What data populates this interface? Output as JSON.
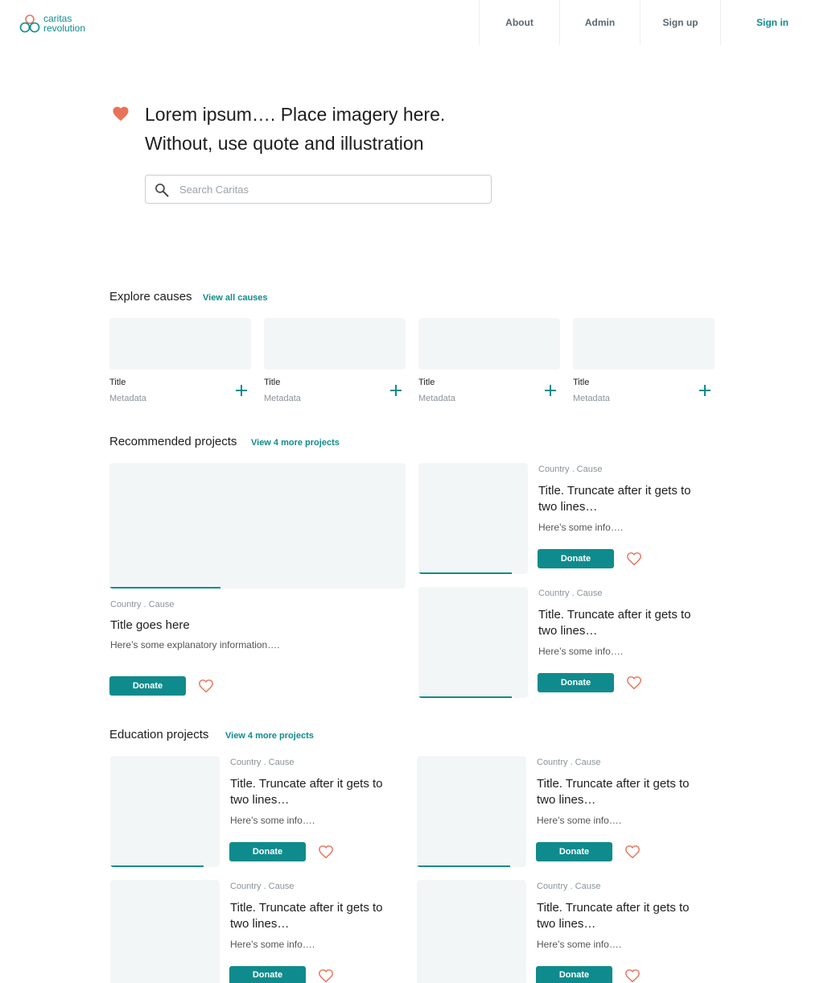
{
  "brand": {
    "line1": "caritas",
    "line2": "revolution",
    "accent_color": "#0f8b8d",
    "heart_color": "#e8735a"
  },
  "nav": {
    "about": "About",
    "admin": "Admin",
    "signup": "Sign up",
    "signin": "Sign in"
  },
  "hero": {
    "line1": "Lorem ipsum…. Place imagery here.",
    "line2": "Without, use quote and illustration",
    "search_placeholder": "Search Caritas"
  },
  "causes": {
    "title": "Explore causes",
    "link": "View all causes",
    "items": [
      {
        "title": "Title",
        "meta": "Metadata"
      },
      {
        "title": "Title",
        "meta": "Metadata"
      },
      {
        "title": "Title",
        "meta": "Metadata"
      },
      {
        "title": "Title",
        "meta": "Metadata"
      }
    ]
  },
  "recommended": {
    "title": "Recommended projects",
    "link": "View 4 more projects",
    "featured": {
      "meta": "Country . Cause",
      "title": "Title goes here",
      "info": "Here’s some explanatory information….",
      "donate": "Donate",
      "progress": 0.375
    },
    "items": [
      {
        "meta": "Country . Cause",
        "title1": "Title. Truncate after it gets to",
        "title2": "two lines…",
        "info": "Here’s some info….",
        "donate": "Donate",
        "progress": 0.85
      },
      {
        "meta": "Country . Cause",
        "title1": "Title. Truncate after it gets to",
        "title2": "two lines…",
        "info": "Here’s some info….",
        "donate": "Donate",
        "progress": 0.85
      }
    ]
  },
  "education": {
    "title": "Education projects",
    "link": "View 4 more projects",
    "items": [
      {
        "meta": "Country . Cause",
        "title1": "Title. Truncate after it gets to",
        "title2": "two lines…",
        "info": "Here’s some info….",
        "donate": "Donate",
        "progress": 0.85
      },
      {
        "meta": "Country . Cause",
        "title1": "Title. Truncate after it gets to",
        "title2": "two lines…",
        "info": "Here’s some info….",
        "donate": "Donate",
        "progress": 0.85
      },
      {
        "meta": "Country . Cause",
        "title1": "Title. Truncate after it gets to",
        "title2": "two lines…",
        "info": "Here’s some info….",
        "donate": "Donate",
        "progress": 0
      },
      {
        "meta": "Country . Cause",
        "title1": "Title. Truncate after it gets to",
        "title2": "two lines…",
        "info": "Here’s some info….",
        "donate": "Donate",
        "progress": 0
      }
    ]
  }
}
